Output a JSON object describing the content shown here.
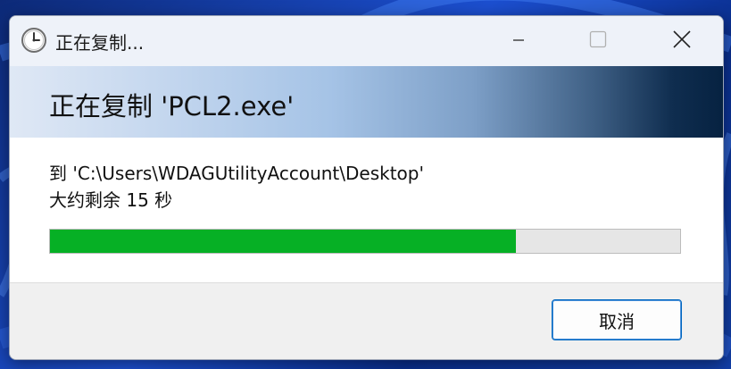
{
  "window": {
    "title": "正在复制..."
  },
  "header": {
    "title": "正在复制 'PCL2.exe'"
  },
  "details": {
    "destination": "到 'C:\\Users\\WDAGUtilityAccount\\Desktop'",
    "time_remaining": "大约剩余 15 秒"
  },
  "progress": {
    "percent": 74
  },
  "footer": {
    "cancel_label": "取消"
  },
  "icons": {
    "title": "clock-icon",
    "minimize": "minimize-icon",
    "maximize": "maximize-icon",
    "close": "close-icon"
  },
  "colors": {
    "progress_fill": "#06b025",
    "progress_track": "#e6e6e6",
    "button_border": "#0067c0"
  }
}
